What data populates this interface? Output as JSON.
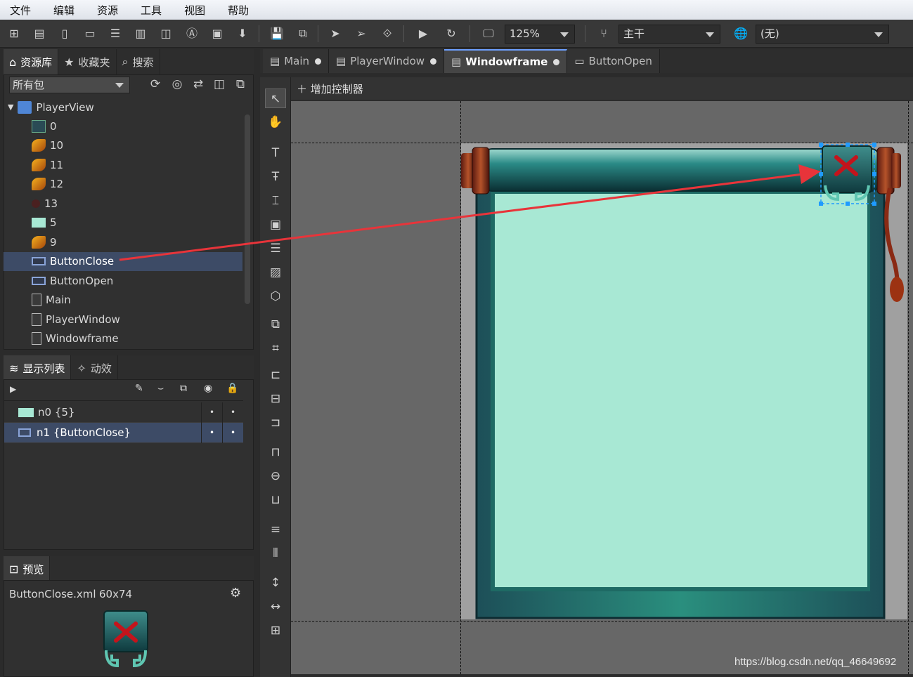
{
  "menu": [
    "文件",
    "编辑",
    "资源",
    "工具",
    "视图",
    "帮助"
  ],
  "toolbar": {
    "zoom": "125%",
    "branch": "主干",
    "language": "(无)"
  },
  "library": {
    "tabs": [
      "资源库",
      "收藏夹",
      "搜索"
    ],
    "filter": "所有包",
    "package": "PlayerView",
    "items": [
      {
        "label": "0",
        "icon": "component"
      },
      {
        "label": "10",
        "icon": "image"
      },
      {
        "label": "11",
        "icon": "image"
      },
      {
        "label": "12",
        "icon": "image"
      },
      {
        "label": "13",
        "icon": "image-dark"
      },
      {
        "label": "5",
        "icon": "graph-rect"
      },
      {
        "label": "9",
        "icon": "image"
      },
      {
        "label": "ButtonClose",
        "icon": "button",
        "selected": true
      },
      {
        "label": "ButtonOpen",
        "icon": "button"
      },
      {
        "label": "Main",
        "icon": "document"
      },
      {
        "label": "PlayerWindow",
        "icon": "document"
      },
      {
        "label": "Windowframe",
        "icon": "document"
      }
    ]
  },
  "display_list": {
    "tabs": [
      "显示列表",
      "动效"
    ],
    "rows": [
      {
        "label": "n0 {5}",
        "icon": "graph-rect"
      },
      {
        "label": "n1 {ButtonClose}",
        "icon": "button",
        "selected": true
      }
    ]
  },
  "preview": {
    "tab": "预览",
    "file": "ButtonClose.xml",
    "size": "60x74"
  },
  "documents": {
    "tabs": [
      {
        "label": "Main",
        "modified": true
      },
      {
        "label": "PlayerWindow",
        "modified": true
      },
      {
        "label": "Windowframe",
        "modified": true,
        "active": true
      },
      {
        "label": "ButtonOpen",
        "modified": false
      }
    ],
    "add_controller": "增加控制器"
  },
  "colors": {
    "accent": "#6ea0ff",
    "selection": "#3d4b66",
    "frame_teal": "#1f5a60",
    "panel_mint": "#a8e8d4",
    "arrow_red": "#e8343a"
  },
  "watermark": "https://blog.csdn.net/qq_46649692"
}
